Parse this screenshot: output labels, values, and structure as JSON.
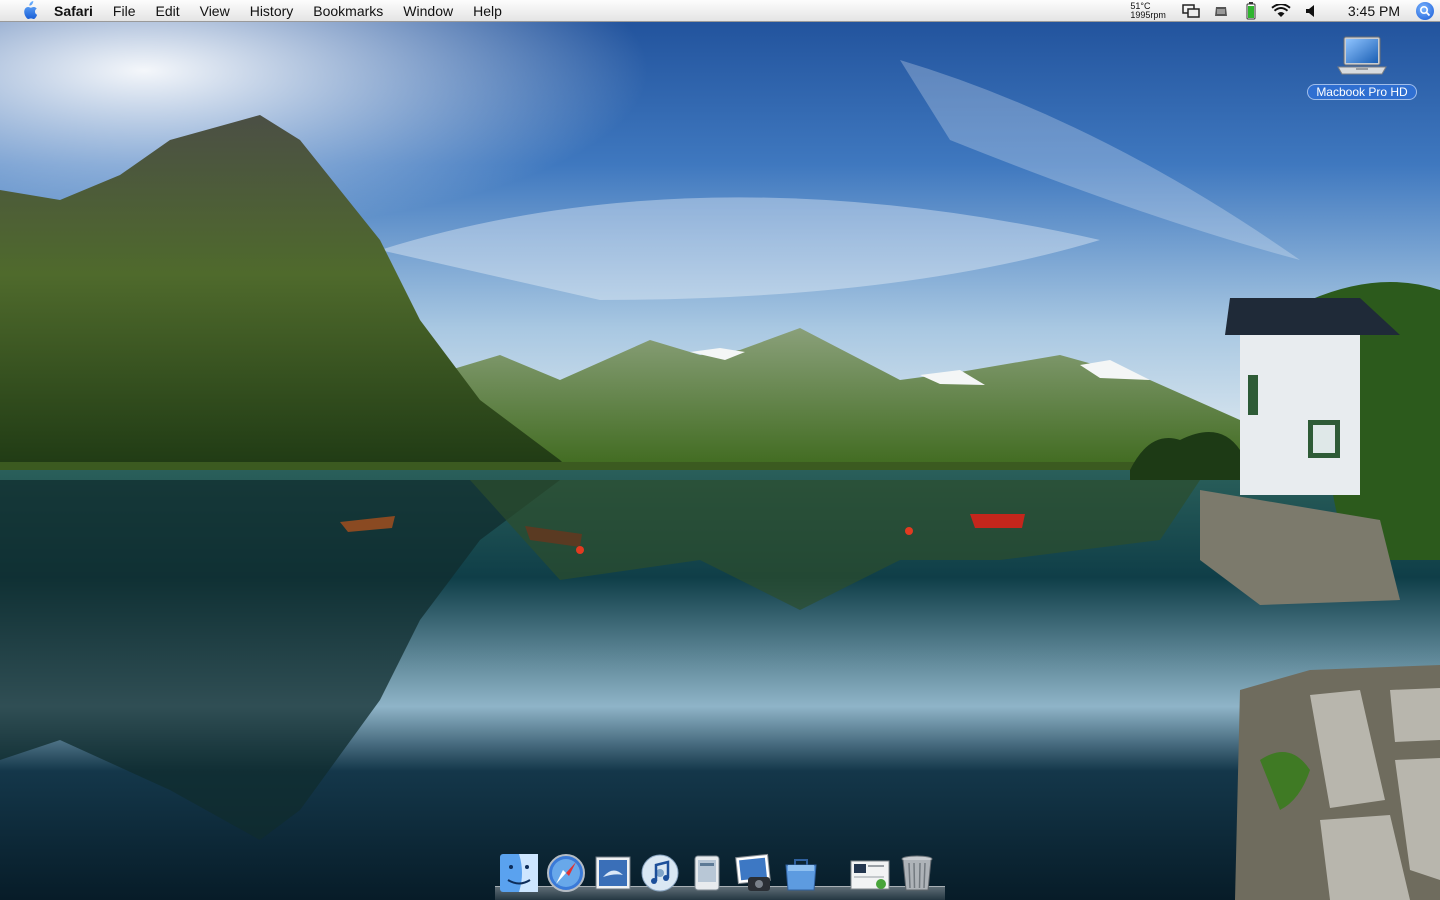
{
  "menubar": {
    "app_name": "Safari",
    "menus": [
      "File",
      "Edit",
      "View",
      "History",
      "Bookmarks",
      "Window",
      "Help"
    ],
    "status": {
      "temperature": "51°C",
      "fan_speed": "1995rpm",
      "clock": "3:45 PM"
    }
  },
  "desktop": {
    "drive_label": "Macbook Pro HD"
  },
  "dock": {
    "items": [
      "finder-icon",
      "safari-icon",
      "mail-icon",
      "itunes-icon",
      "preview-icon",
      "iphoto-icon",
      "pages-icon"
    ],
    "right_items": [
      "downloads-folder-icon",
      "trash-icon"
    ]
  },
  "colors": {
    "sky_top": "#1d4f9a",
    "sky_horizon": "#cfe3f2",
    "water": "#0f3e48",
    "selection_blue": "#2f6fd1"
  }
}
